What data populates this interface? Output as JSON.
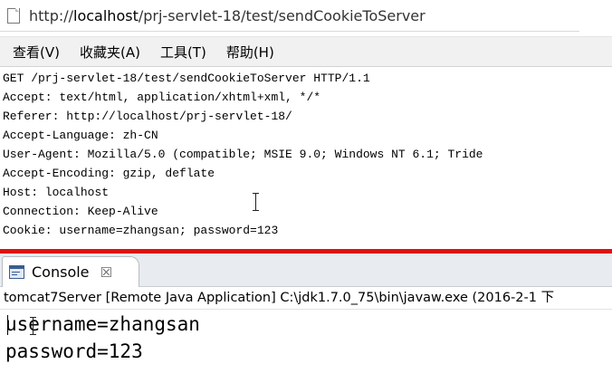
{
  "browser": {
    "url_prefix": "http://",
    "url_host": "localhost",
    "url_path": "/prj-servlet-18/test/sendCookieToServer",
    "page_icon": "page-icon"
  },
  "menu": {
    "items": [
      {
        "label": "查看(V)"
      },
      {
        "label": "收藏夹(A)"
      },
      {
        "label": "工具(T)"
      },
      {
        "label": "帮助(H)"
      }
    ]
  },
  "request": {
    "lines": [
      "GET /prj-servlet-18/test/sendCookieToServer HTTP/1.1",
      "Accept: text/html, application/xhtml+xml, */*",
      "Referer: http://localhost/prj-servlet-18/",
      "Accept-Language: zh-CN",
      "User-Agent: Mozilla/5.0 (compatible; MSIE 9.0; Windows NT 6.1; Tride",
      "Accept-Encoding: gzip, deflate",
      "Host: localhost",
      "Connection: Keep-Alive",
      "Cookie: username=zhangsan; password=123"
    ]
  },
  "divider_color": "#e01010",
  "console": {
    "tab_label": "Console",
    "tab_icon": "console-icon",
    "close_glyph": "☒",
    "process": "tomcat7Server [Remote Java Application] C:\\jdk1.7.0_75\\bin\\javaw.exe (2016-2-1 下",
    "output": [
      "username=zhangsan",
      "password=123"
    ]
  }
}
